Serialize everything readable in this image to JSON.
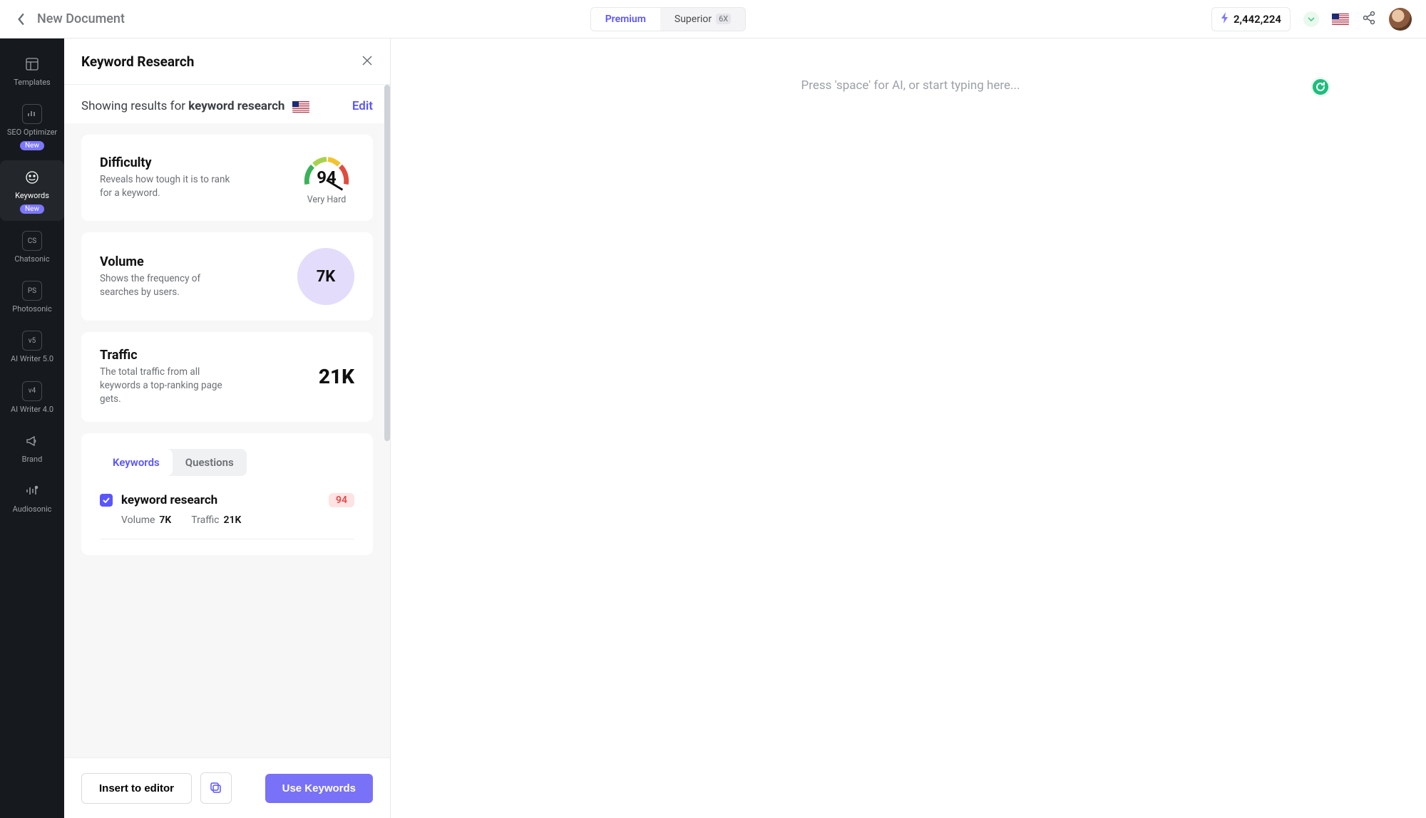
{
  "header": {
    "doc_title": "New Document",
    "plan_premium": "Premium",
    "plan_superior": "Superior",
    "superior_mult": "6X",
    "credits": "2,442,224"
  },
  "sidebar": {
    "items": [
      {
        "label": "Templates",
        "icon": "templates"
      },
      {
        "label": "SEO Optimizer",
        "icon": "seo",
        "badge": "New"
      },
      {
        "label": "Keywords",
        "icon": "keywords",
        "badge": "New",
        "active": true
      },
      {
        "label": "Chatsonic",
        "icon": "cs"
      },
      {
        "label": "Photosonic",
        "icon": "ps"
      },
      {
        "label": "AI Writer 5.0",
        "icon": "v5"
      },
      {
        "label": "AI Writer 4.0",
        "icon": "v4"
      },
      {
        "label": "Brand",
        "icon": "megaphone"
      },
      {
        "label": "Audiosonic",
        "icon": "audio"
      }
    ]
  },
  "panel": {
    "title": "Keyword Research",
    "showing_prefix": "Showing results for ",
    "keyword": "keyword research",
    "edit": "Edit",
    "difficulty": {
      "title": "Difficulty",
      "desc": "Reveals how tough it is to rank for a keyword.",
      "value": "94",
      "label": "Very Hard"
    },
    "volume": {
      "title": "Volume",
      "desc": "Shows the frequency of searches by users.",
      "value": "7K"
    },
    "traffic": {
      "title": "Traffic",
      "desc": "The total traffic from all keywords a top-ranking page gets.",
      "value": "21K"
    },
    "tabs": {
      "keywords": "Keywords",
      "questions": "Questions"
    },
    "keyword_rows": [
      {
        "name": "keyword research",
        "difficulty": "94",
        "volume_label": "Volume",
        "volume": "7K",
        "traffic_label": "Traffic",
        "traffic": "21K",
        "checked": true
      }
    ],
    "footer": {
      "insert": "Insert to editor",
      "use": "Use Keywords"
    }
  },
  "editor": {
    "placeholder": "Press 'space' for AI, or start typing here..."
  }
}
